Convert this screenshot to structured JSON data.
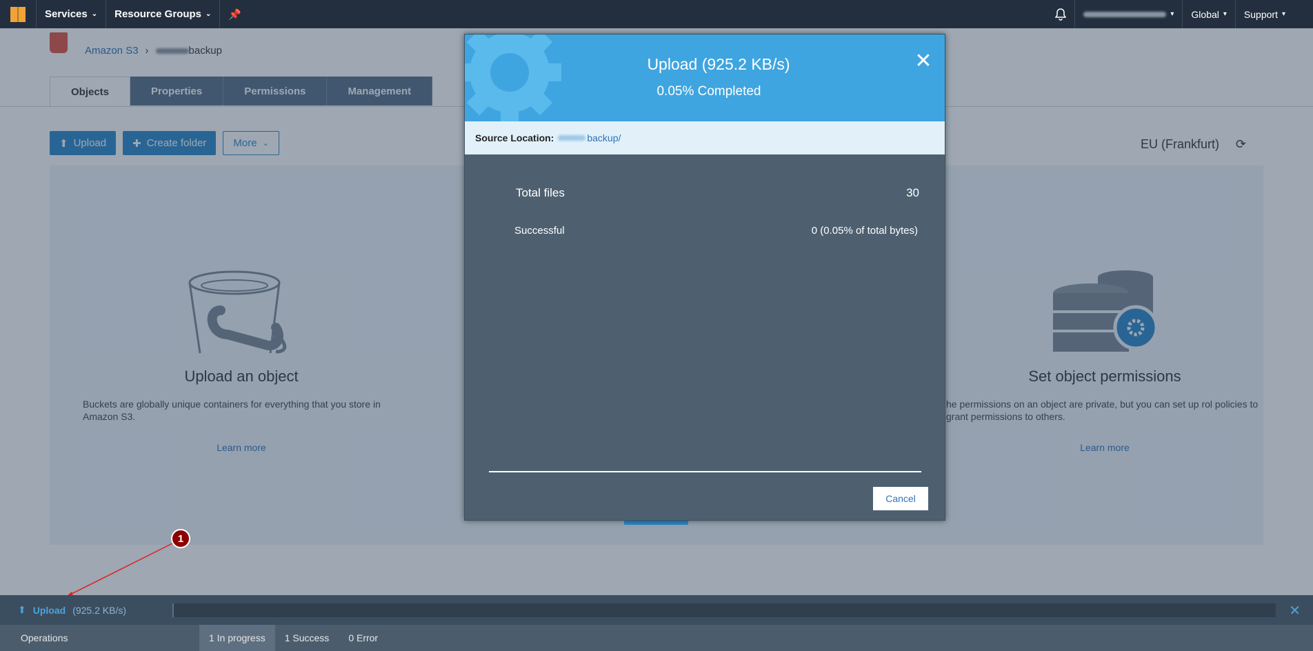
{
  "topnav": {
    "services": "Services",
    "resource_groups": "Resource Groups",
    "region_menu": "Global",
    "support_menu": "Support"
  },
  "breadcrumb": {
    "root": "Amazon S3",
    "bucket": "backup"
  },
  "tabs": [
    "Objects",
    "Properties",
    "Permissions",
    "Management"
  ],
  "actions": {
    "upload": "Upload",
    "create_folder": "Create folder",
    "more": "More"
  },
  "region": "EU (Frankfurt)",
  "cards": [
    {
      "title": "Upload an object",
      "desc": "Buckets are globally unique containers for everything that you store in Amazon S3.",
      "learn": "Learn more"
    },
    {
      "title": "Set object permissions",
      "desc": "he permissions on an object are private, but you can set up rol policies to grant permissions to others.",
      "learn": "Learn more"
    }
  ],
  "modal": {
    "title": "Upload (925.2 KB/s)",
    "subtitle": "0.05% Completed",
    "source_label": "Source Location:",
    "source_value": "backup/",
    "total_files_label": "Total files",
    "total_files_value": "30",
    "successful_label": "Successful",
    "successful_value": "0 (0.05% of total bytes)",
    "cancel": "Cancel"
  },
  "annotation": "1",
  "opbar": {
    "upload_label": "Upload",
    "upload_speed": "(925.2 KB/s)",
    "operations": "Operations",
    "tabs": [
      "1 In progress",
      "1 Success",
      "0 Error"
    ]
  },
  "colors": {
    "nav": "#232f3e",
    "primary": "#2a88c8",
    "modal_header": "#3fa5e0",
    "modal_body": "#4e6070",
    "annotation": "#8b0000"
  }
}
